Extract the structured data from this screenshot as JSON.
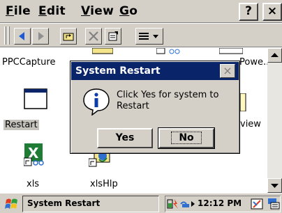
{
  "menu": {
    "items": [
      "File",
      "Edit",
      "View",
      "Go"
    ],
    "help_label": "?",
    "close_label": "×"
  },
  "toolbar": {
    "icons": [
      "back-icon",
      "forward-icon",
      "up-folder-icon",
      "delete-icon",
      "properties-icon",
      "view-menu-icon"
    ]
  },
  "files": [
    {
      "label": "PPCCapture",
      "icon": "program-icon"
    },
    {
      "label": "Restart",
      "icon": "window-app-icon",
      "selected": true
    },
    {
      "label": "xls",
      "icon": "excel-shortcut-icon"
    },
    {
      "label": "xlsHlp",
      "icon": "help-shortcut-icon"
    },
    {
      "label": "Powe...",
      "icon": "program-icon"
    },
    {
      "label": "view",
      "icon": "document-icon"
    }
  ],
  "dialog": {
    "title": "System Restart",
    "close_label": "×",
    "message": "Click Yes for system to Restart",
    "yes_label": "Yes",
    "no_label": "No",
    "icon": "info-icon"
  },
  "taskbar": {
    "active_task": "System Restart",
    "clock": "12:12 PM",
    "tray_icons": [
      "battery-icon",
      "network-icon",
      "speaker-arrow-icon",
      "pen-icon",
      "input-panel-icon"
    ]
  },
  "colors": {
    "titlebar": "#0a246a",
    "chrome": "#d4d0c8"
  }
}
